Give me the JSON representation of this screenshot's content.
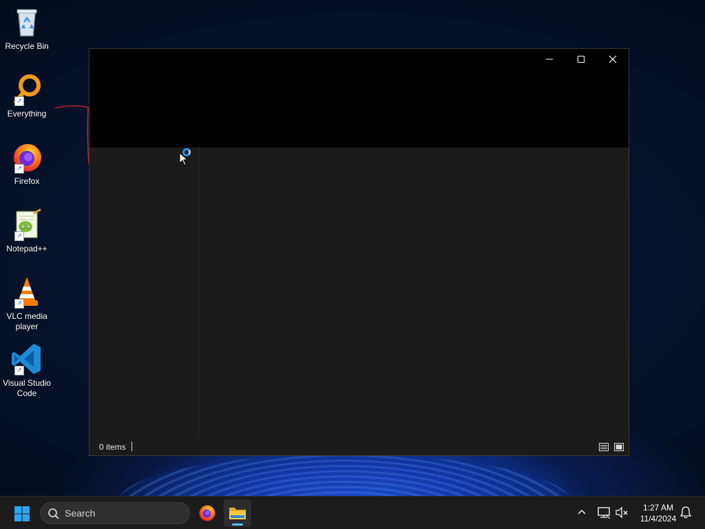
{
  "desktop": {
    "icons": [
      {
        "label": "Recycle Bin",
        "icon": "recycle-bin-icon"
      },
      {
        "label": "Everything",
        "icon": "everything-search-icon"
      },
      {
        "label": "Firefox",
        "icon": "firefox-icon"
      },
      {
        "label": "Notepad++",
        "icon": "notepad-plus-plus-icon"
      },
      {
        "label": "VLC media player",
        "icon": "vlc-icon"
      },
      {
        "label": "Visual Studio Code",
        "icon": "vscode-icon"
      }
    ]
  },
  "window": {
    "controls": {
      "minimize": "minimize-icon",
      "maximize": "maximize-icon",
      "close": "close-icon"
    },
    "status": {
      "item_count": "0 items"
    },
    "view_buttons": [
      "details-view-icon",
      "large-icons-view-icon"
    ]
  },
  "taskbar": {
    "search_label": "Search",
    "apps": [
      "firefox-icon",
      "file-explorer-icon"
    ],
    "clock": {
      "time": "1:27 AM",
      "date": "11/4/2024"
    }
  },
  "colors": {
    "accent": "#4cc2ff",
    "window_bg": "#191919",
    "titlebar_bg": "#000000",
    "taskbar_bg": "#1c1c1c",
    "annotation_red": "#b0242a"
  }
}
